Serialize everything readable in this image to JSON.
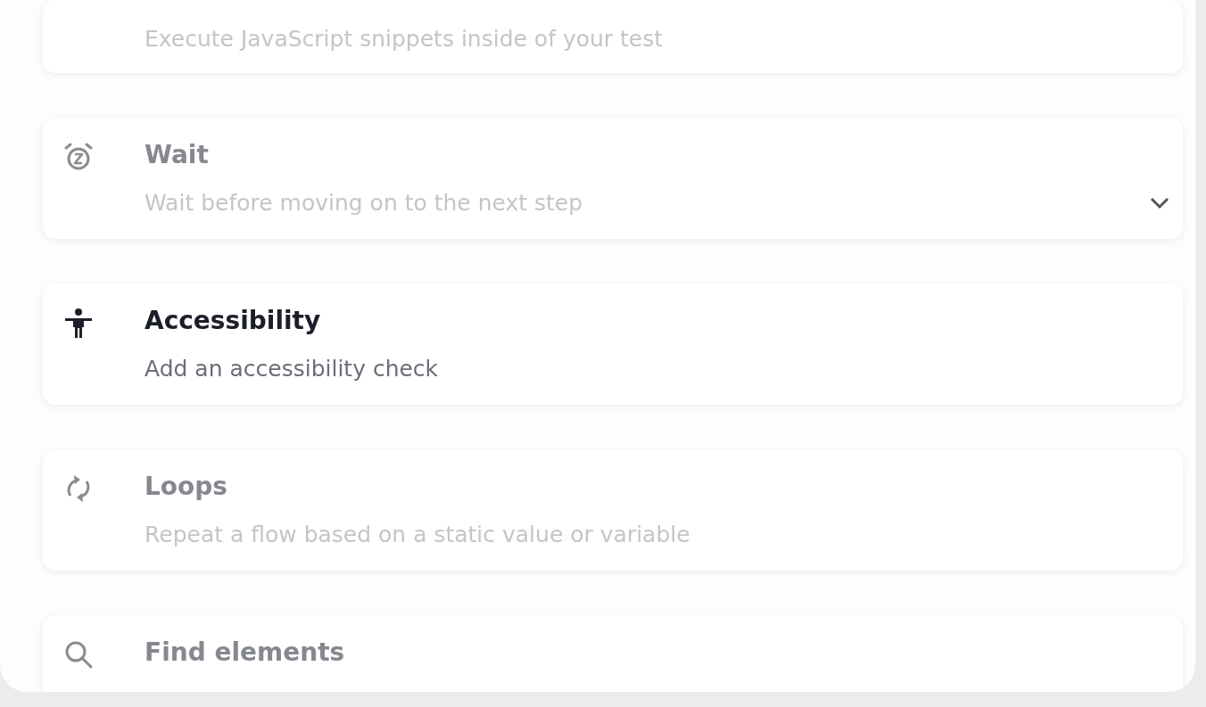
{
  "steps": [
    {
      "kind": "plain",
      "description": "Execute JavaScript snippets inside of your test",
      "selected": false,
      "chevron": false
    },
    {
      "kind": "alarm",
      "title": "Wait",
      "description": "Wait before moving on to the next step",
      "selected": false,
      "chevron": true
    },
    {
      "kind": "accessibility",
      "title": "Accessibility",
      "description": "Add an accessibility check",
      "selected": true,
      "chevron": false
    },
    {
      "kind": "loop",
      "title": "Loops",
      "description": "Repeat a flow based on a static value or variable",
      "selected": false,
      "chevron": false
    },
    {
      "kind": "search",
      "title": "Find elements",
      "selected": false,
      "chevron": false
    }
  ]
}
